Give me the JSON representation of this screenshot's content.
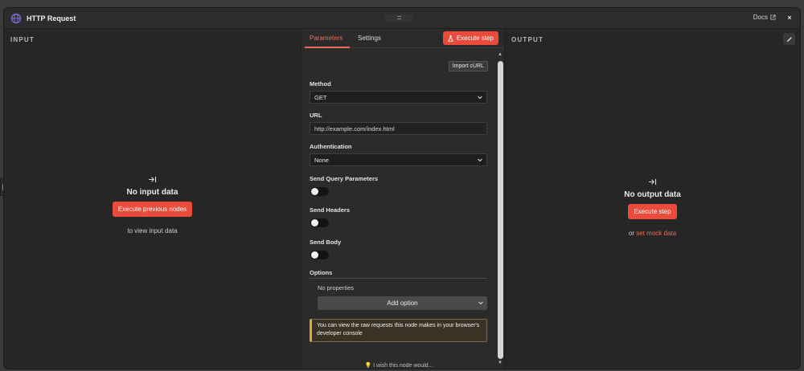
{
  "header": {
    "title": "HTTP Request",
    "docs_label": "Docs",
    "close_label": "×"
  },
  "input_panel": {
    "label": "INPUT",
    "empty_title": "No input data",
    "execute_prev_label": "Execute previous nodes",
    "hint": "to view input data"
  },
  "output_panel": {
    "label": "OUTPUT",
    "empty_title": "No output data",
    "execute_label": "Execute step",
    "hint_prefix": "or",
    "mock_link": "set mock data"
  },
  "tabs": [
    {
      "label": "Parameters",
      "active": true
    },
    {
      "label": "Settings",
      "active": false
    }
  ],
  "execute_step_label": "Execute step",
  "form": {
    "import_curl_label": "Import cURL",
    "method": {
      "label": "Method",
      "value": "GET"
    },
    "url": {
      "label": "URL",
      "value": "http://example.com/index.html"
    },
    "authentication": {
      "label": "Authentication",
      "value": "None"
    },
    "send_query": {
      "label": "Send Query Parameters",
      "enabled": false
    },
    "send_headers": {
      "label": "Send Headers",
      "enabled": false
    },
    "send_body": {
      "label": "Send Body",
      "enabled": false
    },
    "options_label": "Options",
    "no_properties": "No properties",
    "add_option_label": "Add option",
    "notice": "You can view the raw requests this node makes in your browser's developer console",
    "wish_label": "I wish this node would..."
  },
  "colors": {
    "accent": "#ea4b3a",
    "panel_bg": "#262626",
    "center_bg": "#2b2b2b",
    "notice_border": "#e8a33c"
  }
}
